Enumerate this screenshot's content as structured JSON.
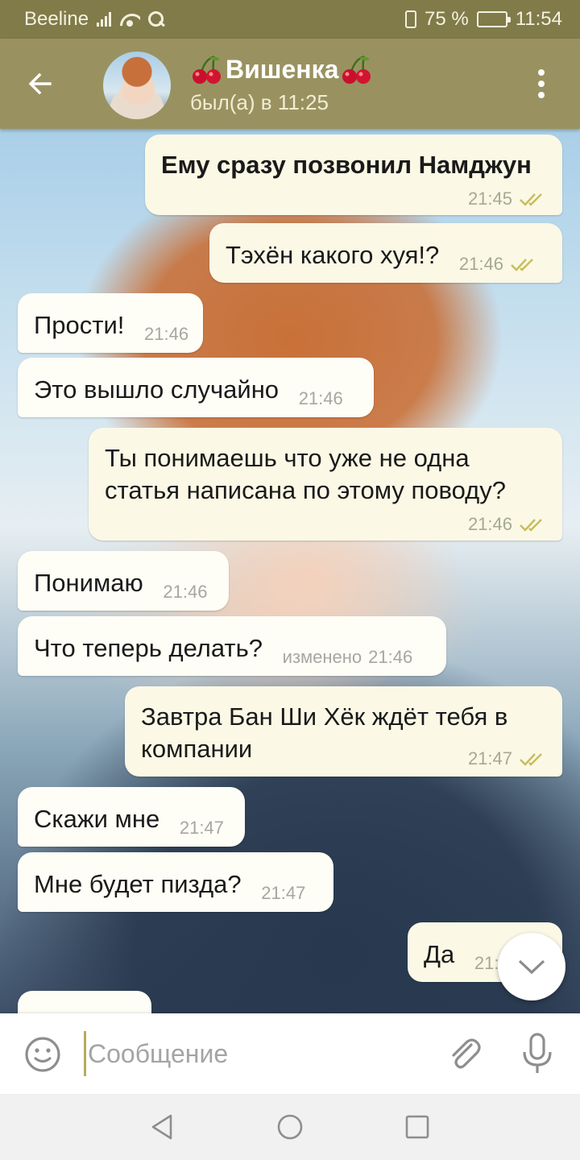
{
  "status_bar": {
    "carrier": "Beeline",
    "battery": "75 %",
    "battery_level": 0.75,
    "time": "11:54"
  },
  "header": {
    "contact_name": "Вишенка",
    "last_seen": "был(а) в 11:25",
    "icons": [
      "back-arrow-icon",
      "cherry-icon",
      "more-vert-icon"
    ]
  },
  "messages": [
    {
      "dir": "out",
      "text": "Ему сразу позвонил Намджун",
      "time": "21:45",
      "read": true,
      "bold": true
    },
    {
      "dir": "out",
      "text": "Тэхён какого хуя!?",
      "time": "21:46",
      "read": true
    },
    {
      "dir": "in",
      "text": "Прости!",
      "time": "21:46"
    },
    {
      "dir": "in",
      "text": "Это вышло случайно",
      "time": "21:46"
    },
    {
      "dir": "out",
      "text": "Ты понимаешь что уже не одна статья написана по этому поводу?",
      "time": "21:46",
      "read": true
    },
    {
      "dir": "in",
      "text": "Понимаю",
      "time": "21:46"
    },
    {
      "dir": "in",
      "text": "Что теперь делать?",
      "time": "21:46",
      "edited": "изменено"
    },
    {
      "dir": "out",
      "text": "Завтра Бан Ши Хёк ждёт тебя в компании",
      "time": "21:47",
      "read": true
    },
    {
      "dir": "in",
      "text": "Скажи мне",
      "time": "21:47"
    },
    {
      "dir": "in",
      "text": "Мне будет пизда?",
      "time": "21:47"
    },
    {
      "dir": "out",
      "text": "Да",
      "time": "21:"
    },
    {
      "dir": "in",
      "text": "",
      "time": ""
    }
  ],
  "input": {
    "placeholder": "Сообщение",
    "icons": [
      "emoji-icon",
      "paperclip-icon",
      "microphone-icon"
    ]
  },
  "colors": {
    "header": "#999260",
    "status_bar": "#817b4a",
    "bubble_in": "#fefdf6",
    "bubble_out": "#fbf8e6",
    "read_check": "#c7bd5a"
  }
}
